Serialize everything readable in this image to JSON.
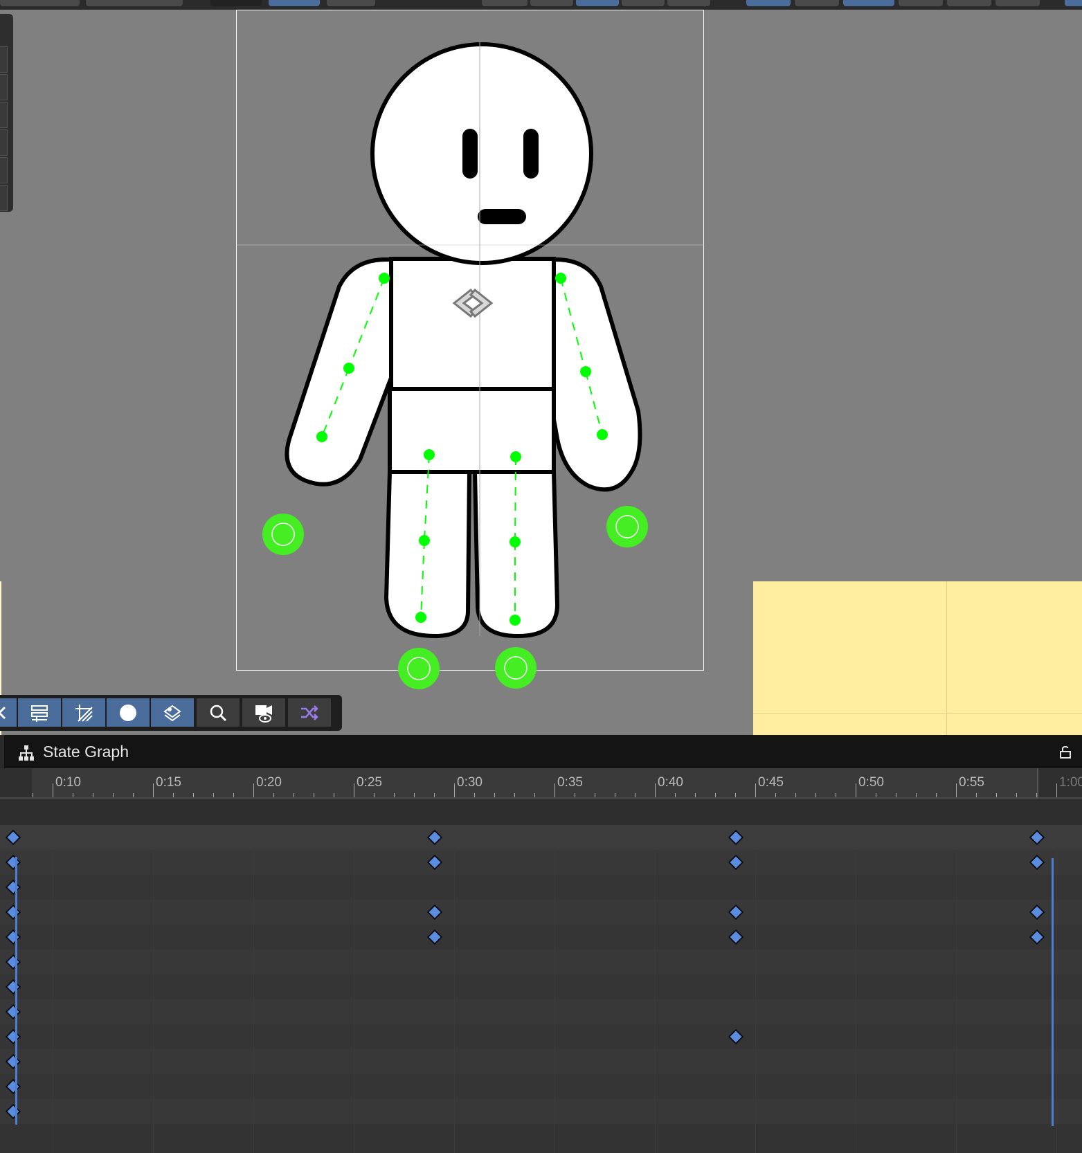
{
  "state_graph": {
    "title": "State Graph"
  },
  "timeline": {
    "tick_labels": [
      "0:10",
      "0:15",
      "0:20",
      "0:25",
      "0:30",
      "0:35",
      "0:40",
      "0:45",
      "0:50",
      "0:55",
      "1:00"
    ],
    "rows": [
      {
        "keys": [
          "0:09",
          "0:29",
          "0:44",
          "0:59"
        ]
      },
      {
        "keys": [
          "0:09",
          "0:29",
          "0:44",
          "0:59"
        ]
      },
      {
        "keys": [
          "0:09"
        ]
      },
      {
        "keys": [
          "0:09",
          "0:29",
          "0:44",
          "0:59"
        ]
      },
      {
        "keys": [
          "0:09",
          "0:29",
          "0:44",
          "0:59"
        ]
      },
      {
        "keys": [
          "0:09"
        ]
      },
      {
        "keys": [
          "0:09"
        ]
      },
      {
        "keys": [
          "0:09"
        ]
      },
      {
        "keys": [
          "0:09",
          "0:44"
        ]
      },
      {
        "keys": [
          "0:09"
        ]
      },
      {
        "keys": [
          "0:09"
        ]
      },
      {
        "keys": [
          "0:09"
        ]
      }
    ]
  },
  "canvas_toolbar": {
    "tools": [
      "collapse-icon",
      "sliders-icon",
      "grid-snap-icon",
      "circle-icon",
      "layers-icon",
      "search-icon",
      "camera-view-icon",
      "shuffle-icon"
    ]
  },
  "colors": {
    "bone_handle": "#00ff00",
    "ik_target": "#44ee22",
    "keyframe": "#5a8de0",
    "sticky_note": "#ffeda0"
  }
}
